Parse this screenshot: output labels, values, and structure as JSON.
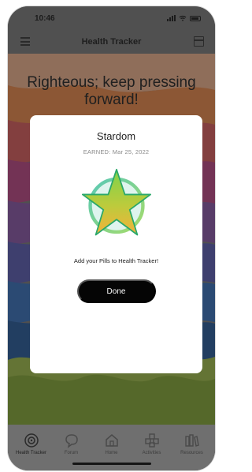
{
  "status_bar": {
    "time": "10:46"
  },
  "nav": {
    "title": "Health Tracker"
  },
  "motivation": "Righteous; keep pressing forward!",
  "modal": {
    "award_title": "Stardom",
    "earned_date": "EARNED: Mar 25, 2022",
    "message": "Add your Pills to Health Tracker!",
    "done_label": "Done"
  },
  "tabs": [
    {
      "label": "Health Tracker",
      "icon": "tracker-icon",
      "active": true
    },
    {
      "label": "Forum",
      "icon": "chat-bubble-icon",
      "active": false
    },
    {
      "label": "Home",
      "icon": "home-icon",
      "active": false
    },
    {
      "label": "Activities",
      "icon": "activities-icon",
      "active": false
    },
    {
      "label": "Resources",
      "icon": "resources-icon",
      "active": false
    }
  ],
  "colors": {
    "accent": "#050505",
    "star_gold": "#f2b53a",
    "star_green": "#8ed14a",
    "ring_teal": "#58c9b4"
  }
}
